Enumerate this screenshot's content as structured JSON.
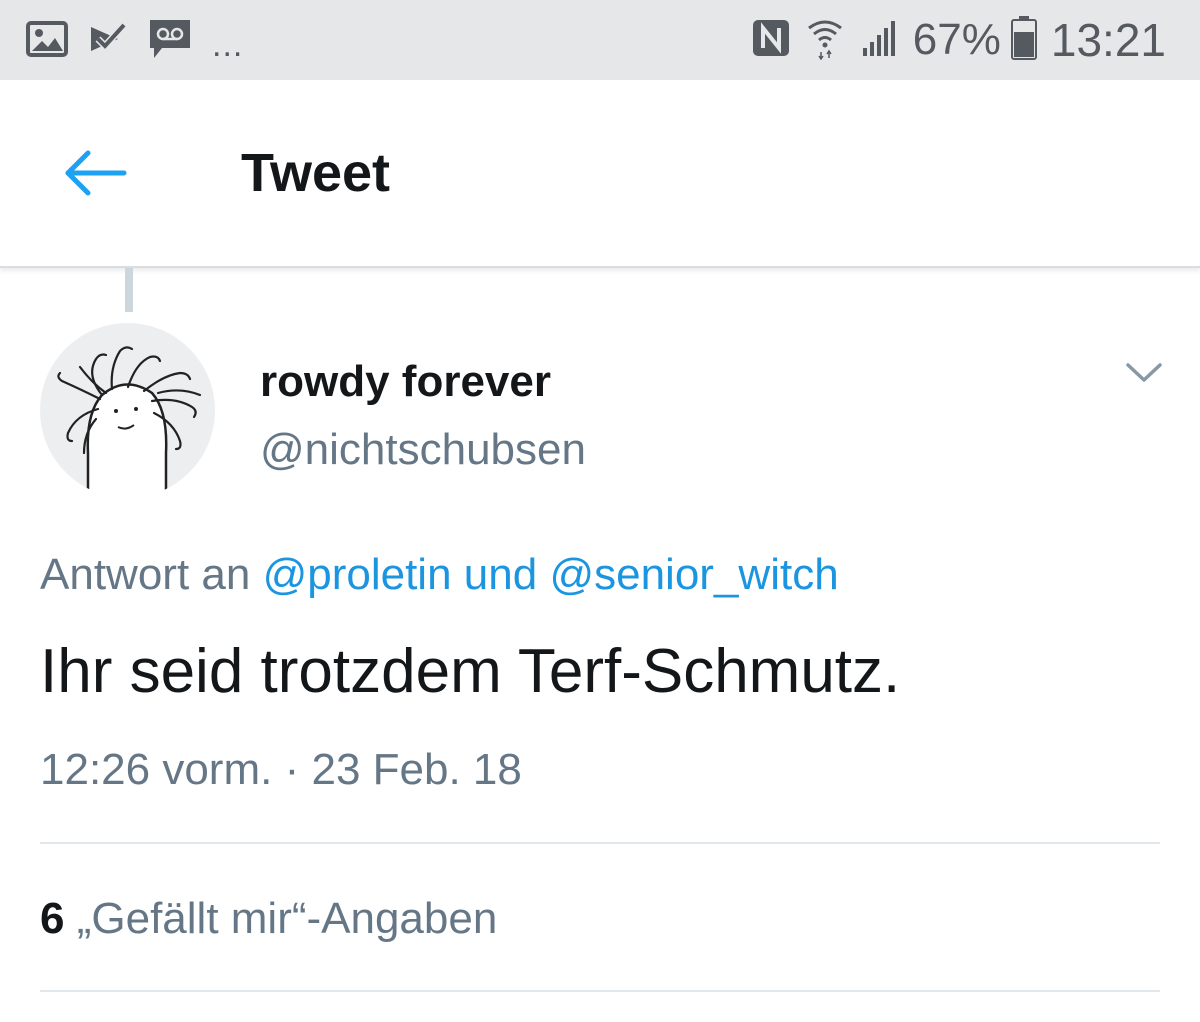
{
  "status_bar": {
    "overflow": "...",
    "battery_percent": "67%",
    "time": "13:21",
    "icons": [
      "gallery-icon",
      "task-check-icon",
      "voicemail-icon",
      "nfc-icon",
      "wifi-icon",
      "signal-icon",
      "battery-icon"
    ]
  },
  "header": {
    "title": "Tweet",
    "back_icon": "back-arrow-icon",
    "accent_color": "#1da1f2"
  },
  "tweet": {
    "display_name": "rowdy forever",
    "handle": "@nichtschubsen",
    "reply_prefix": "Antwort an",
    "reply_to_1": "@proletin",
    "reply_and": "und",
    "reply_to_2": "@senior_witch",
    "text": "Ihr seid trotzdem Terf-Schmutz.",
    "time": "12:26 vorm.",
    "separator": "·",
    "date": "23 Feb. 18",
    "likes_count": "6",
    "likes_label": "„Gefällt mir“-Angaben",
    "menu_icon": "chevron-down-icon",
    "link_color": "#1b95e0",
    "muted_color": "#657786"
  }
}
